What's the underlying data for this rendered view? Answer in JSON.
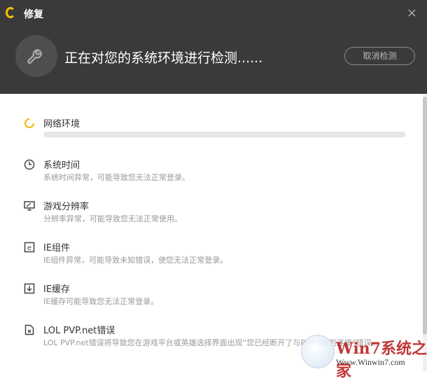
{
  "window": {
    "title": "修复",
    "close": "×"
  },
  "header": {
    "headline": "正在对您的系统环境进行检测......",
    "cancel_label": "取消检测"
  },
  "items": [
    {
      "name": "网络环境",
      "icon": "spinner-icon",
      "progress": 0
    },
    {
      "name": "系统时间",
      "desc": "系统时间异常，可能导致您无法正常登录。",
      "icon": "clock-icon"
    },
    {
      "name": "游戏分辨率",
      "desc": "分辨率异常，可能导致您无法正常使用。",
      "icon": "monitor-icon"
    },
    {
      "name": "IE组件",
      "desc": "IE组件异常，可能导致未知错误，使您无法正常登录。",
      "icon": "ie-icon"
    },
    {
      "name": "IE缓存",
      "desc": "IE缓存可能导致您无法正常登录。",
      "icon": "download-box-icon"
    },
    {
      "name": "LOL PVP.net错误",
      "desc": "LOL PVP.net错误将导致您在游戏平台或英雄选择界面出现“您已经断开了与PVP.net的连接”错误。",
      "icon": "file-error-icon"
    }
  ],
  "watermark": {
    "brand": "Win7系统之家",
    "url": "Www.Winwin7.com"
  }
}
